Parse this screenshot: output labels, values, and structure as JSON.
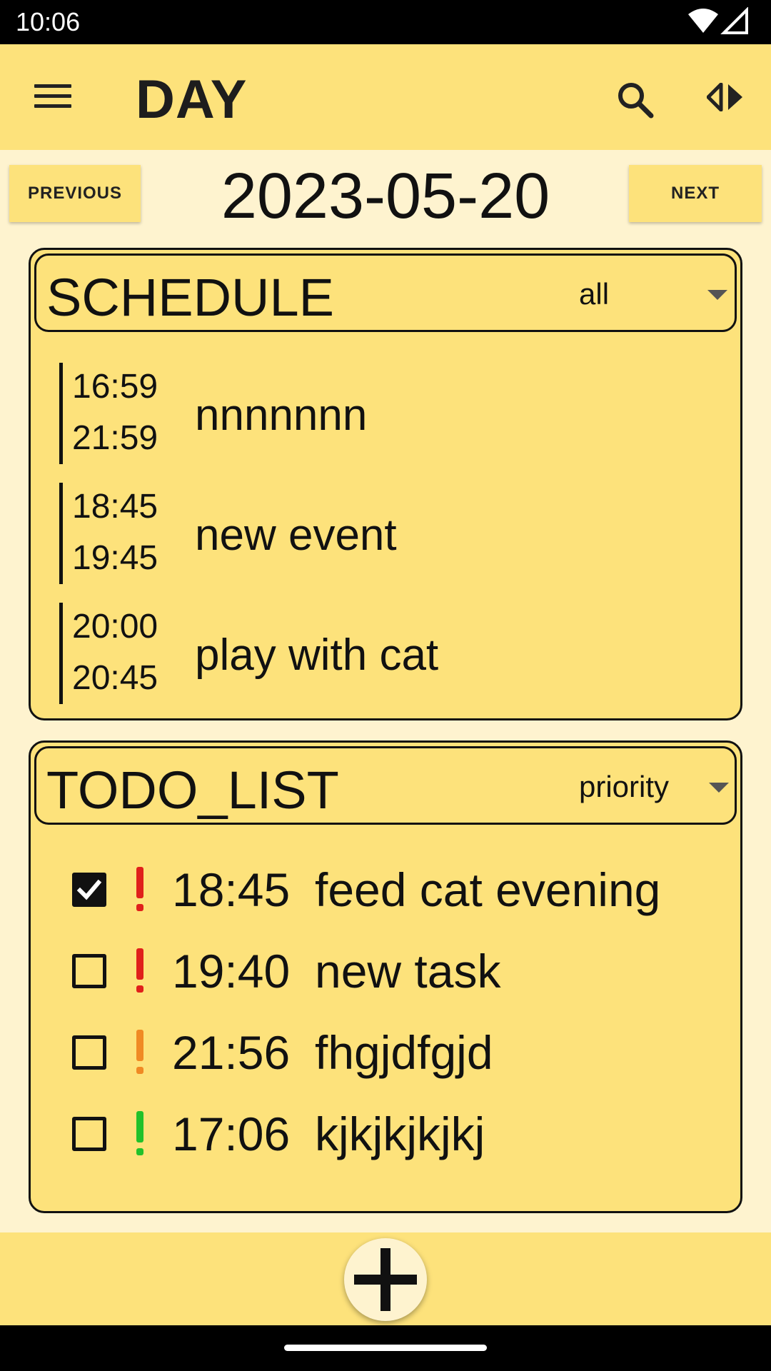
{
  "status_bar": {
    "time": "10:06",
    "icons": [
      "wifi-icon",
      "signal-icon"
    ]
  },
  "app_bar": {
    "title": "DAY",
    "icons": [
      "menu-icon",
      "search-icon",
      "swap-view-icon"
    ]
  },
  "date_nav": {
    "previous_label": "PREVIOUS",
    "date": "2023-05-20",
    "next_label": "NEXT"
  },
  "schedule": {
    "title": "SCHEDULE",
    "filter": "all",
    "events": [
      {
        "start": "16:59",
        "end": "21:59",
        "title": "nnnnnnn"
      },
      {
        "start": "18:45",
        "end": "19:45",
        "title": "new event"
      },
      {
        "start": "20:00",
        "end": "20:45",
        "title": "play with cat"
      }
    ]
  },
  "todo_list": {
    "title": "TODO_LIST",
    "sort": "priority",
    "items": [
      {
        "checked": true,
        "priority_color": "#E0201B",
        "time": "18:45",
        "title": "feed cat evening"
      },
      {
        "checked": false,
        "priority_color": "#E0201B",
        "time": "19:40",
        "title": "new task"
      },
      {
        "checked": false,
        "priority_color": "#F08A24",
        "time": "21:56",
        "title": "fhgjdfgjd"
      },
      {
        "checked": false,
        "priority_color": "#22C12A",
        "time": "17:06",
        "title": "kjkjkjkjkj"
      }
    ]
  },
  "fab": {
    "icon": "plus-icon"
  },
  "colors": {
    "background": "#FEF3CF",
    "accent": "#FDE27B"
  }
}
